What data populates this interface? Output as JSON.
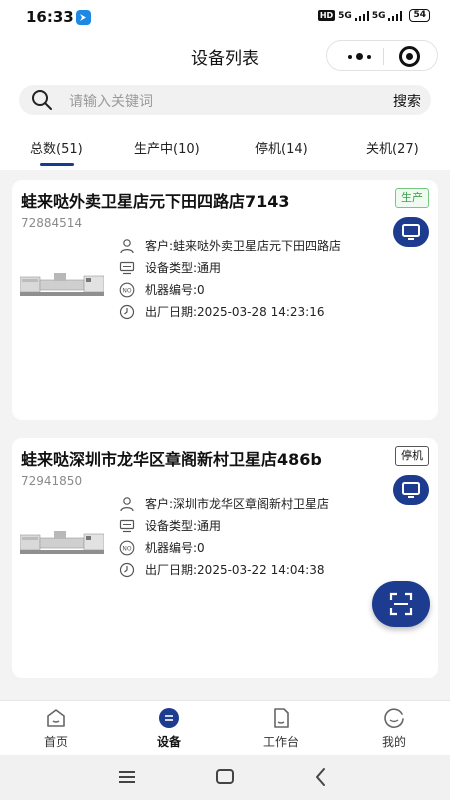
{
  "status_bar": {
    "time": "16:33",
    "hd": "HD",
    "signal_1": "5G",
    "signal_2": "5G",
    "battery": "54"
  },
  "header": {
    "title": "设备列表"
  },
  "search": {
    "placeholder": "请输入关键词",
    "button_label": "搜索"
  },
  "tabs": [
    {
      "label": "总数(51)",
      "active": true
    },
    {
      "label": "生产中(10)",
      "active": false
    },
    {
      "label": "停机(14)",
      "active": false
    },
    {
      "label": "关机(27)",
      "active": false
    }
  ],
  "devices": [
    {
      "name": "蛙来哒外卖卫星店元下田四路店7143",
      "code": "72884514",
      "status": "生产",
      "customer": "客户:蛙来哒外卖卫星店元下田四路店",
      "type": "设备类型:通用",
      "machine_no": "机器编号:0",
      "factory_date": "出厂日期:2025-03-28 14:23:16"
    },
    {
      "name": "蛙来哒深圳市龙华区章阁新村卫星店486b",
      "code": "72941850",
      "status": "停机",
      "customer": "客户:深圳市龙华区章阁新村卫星店",
      "type": "设备类型:通用",
      "machine_no": "机器编号:0",
      "factory_date": "出厂日期:2025-03-22 14:04:38"
    }
  ],
  "bottom_nav": [
    {
      "label": "首页",
      "icon": "home-icon",
      "active": false
    },
    {
      "label": "设备",
      "icon": "device-icon",
      "active": true
    },
    {
      "label": "工作台",
      "icon": "workbench-icon",
      "active": false
    },
    {
      "label": "我的",
      "icon": "profile-icon",
      "active": false
    }
  ],
  "colors": {
    "primary": "#1d3b8f",
    "producing": "#3aa24a"
  }
}
